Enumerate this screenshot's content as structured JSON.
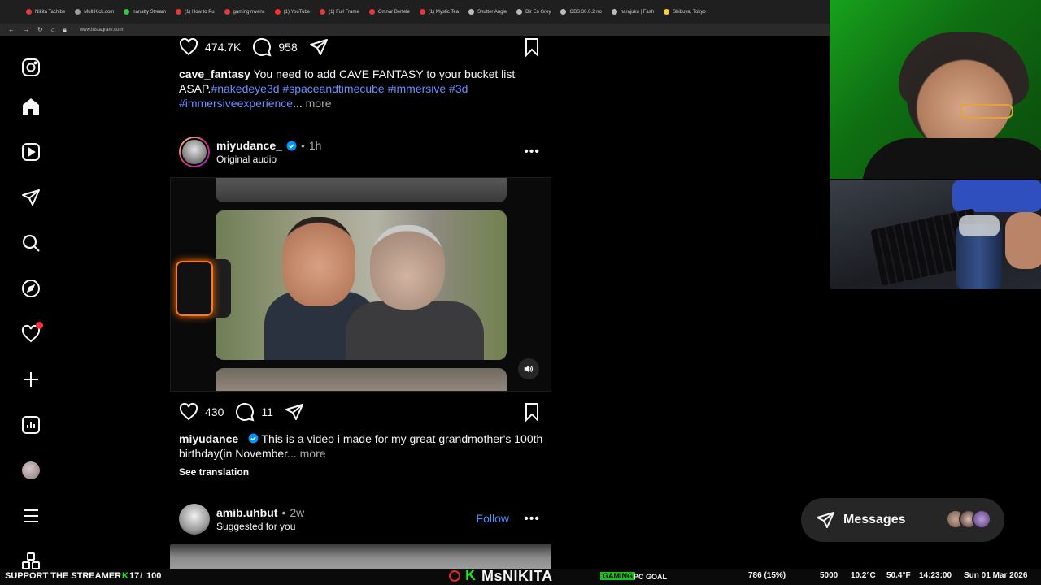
{
  "browser": {
    "tabs": [
      "Nikita Tachibe",
      "MultiKick.com",
      "nanatty Stream",
      "(1) How to Pu",
      "gaming mvenc",
      "(1) YouTube",
      "(1) Full Frame",
      "Omnar Bertele",
      "(1) Mystic Tea",
      "Shutter Angle",
      "Dir En Grey",
      "OBS 30.0.2 no",
      "harajuku | Fash",
      "Shibuya, Tokyo"
    ],
    "tab_colors": [
      "#e03b3b",
      "#9a9a9a",
      "#2ecc40",
      "#e03b3b",
      "#e03b3b",
      "#ff2d2d",
      "#e03b3b",
      "#e03b3b",
      "#e03b3b",
      "#bbbbbb",
      "#bbbbbb",
      "#bbbbbb",
      "#bbbbbb",
      "#ffcc33"
    ],
    "url": "www.instagram.com"
  },
  "sidebar": {
    "items": [
      "instagram-logo-icon",
      "home-icon",
      "reels-icon",
      "direct-send-icon",
      "search-icon",
      "explore-compass-icon",
      "notifications-heart-icon",
      "create-plus-icon",
      "dashboard-icon",
      "profile-avatar",
      "menu-hamburger-icon",
      "also-from-meta-icon"
    ]
  },
  "post1": {
    "likes": "474.7K",
    "comments": "958",
    "username": "cave_fantasy",
    "caption_text": " You need to add CAVE FANTASY to your bucket list ASAP.",
    "hashtags_line1": "#nakedeye3d #spaceandtimecube #immersive #3d",
    "hashtags_line2": "#immersiveexperience",
    "ellipsis": "...",
    "more": "more"
  },
  "post2": {
    "username": "miyudance_",
    "separator": "•",
    "time": "1h",
    "audio": "Original audio",
    "likes": "430",
    "comments": "11",
    "caption_text": " This is a video i made for my great grandmother's 100th birthday(in November...",
    "more": "more",
    "see_translation": "See translation"
  },
  "post3": {
    "username": "amib.uhbut",
    "separator": "•",
    "time": "2w",
    "subtitle": "Suggested for you",
    "follow": "Follow"
  },
  "messages": {
    "label": "Messages"
  },
  "stream_overlay": {
    "support": "SUPPORT THE STREAMER",
    "count_a": "17",
    "count_b": "100",
    "streamer": "MsNIKITA",
    "kick_letter": "K",
    "goal_pill": "GAMING",
    "goal_text": "PC GOAL",
    "goal_progress": "786 (15%)",
    "goal_target": "5000",
    "weather": "10.2°C",
    "weather_f": "50.4°F",
    "time": "14:23:00",
    "date": "Sun 01 Mar 2026"
  },
  "colors": {
    "hashtag": "#6d8dff",
    "follow": "#4a8cff",
    "notification": "#ff3040",
    "kick_green": "#19e51c"
  }
}
